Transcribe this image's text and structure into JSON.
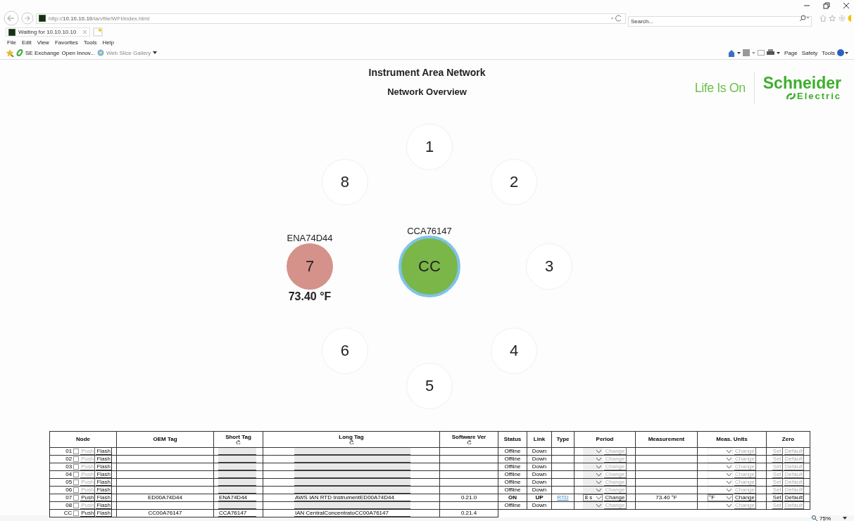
{
  "browser": {
    "url": "http://**10.10.10.10**/ian/file/WFI/index.html",
    "search_placeholder": "Search...",
    "tabs": [
      {
        "title": "Waiting for 10.10.10.10",
        "selected": true
      }
    ],
    "menu": [
      "File",
      "Edit",
      "View",
      "Favorites",
      "Tools",
      "Help"
    ],
    "favorites": [
      {
        "label": "SE Exchange",
        "kind": "link"
      },
      {
        "label": "Open Innov...",
        "kind": "plain"
      },
      {
        "label": "Web Slice Gallery",
        "kind": "gallery"
      }
    ],
    "commands": [
      "Page",
      "Safety",
      "Tools"
    ],
    "zoom": "75%"
  },
  "page": {
    "title": "Instrument Area Network",
    "subtitle": "Network Overview",
    "tagline": "Life Is On",
    "brand": "Schneider",
    "brand_sub": "Electric"
  },
  "center": {
    "label": "CC",
    "tag": "CCA76147"
  },
  "nodes": [
    {
      "label": "1",
      "kind": "empty"
    },
    {
      "label": "2",
      "kind": "empty"
    },
    {
      "label": "3",
      "kind": "empty"
    },
    {
      "label": "4",
      "kind": "empty"
    },
    {
      "label": "5",
      "kind": "empty"
    },
    {
      "label": "6",
      "kind": "empty"
    },
    {
      "label": "7",
      "kind": "sensor",
      "tag": "ENA74D44",
      "reading": "73.40 °F"
    },
    {
      "label": "8",
      "kind": "empty"
    }
  ],
  "table": {
    "columns": [
      {
        "label": "Node"
      },
      {
        "label": "OEM Tag"
      },
      {
        "label": "Short Tag",
        "refresh": true
      },
      {
        "label": "Long Tag",
        "refresh": true
      },
      {
        "label": "Software Ver",
        "refresh": true
      },
      {
        "label": "Status"
      },
      {
        "label": "Link"
      },
      {
        "label": "Type"
      },
      {
        "label": "Period"
      },
      {
        "label": "Measurement"
      },
      {
        "label": "Meas. Units"
      },
      {
        "label": "Zero"
      }
    ],
    "rows": [
      {
        "kind": "node",
        "node": "01",
        "checked": false,
        "enabled": false,
        "push": "Push",
        "flash": "Flash",
        "status": "Offline",
        "link": "Down",
        "period_button": "Change",
        "units_button": "Change",
        "set": "Set",
        "default": "Default"
      },
      {
        "kind": "node",
        "node": "02",
        "checked": false,
        "enabled": false,
        "push": "Push",
        "flash": "Flash",
        "status": "Offline",
        "link": "Down",
        "period_button": "Change",
        "units_button": "Change",
        "set": "Set",
        "default": "Default"
      },
      {
        "kind": "node",
        "node": "03",
        "checked": false,
        "enabled": false,
        "push": "Push",
        "flash": "Flash",
        "status": "Offline",
        "link": "Down",
        "period_button": "Change",
        "units_button": "Change",
        "set": "Set",
        "default": "Default"
      },
      {
        "kind": "node",
        "node": "04",
        "checked": false,
        "enabled": false,
        "push": "Push",
        "flash": "Flash",
        "status": "Offline",
        "link": "Down",
        "period_button": "Change",
        "units_button": "Change",
        "set": "Set",
        "default": "Default"
      },
      {
        "kind": "node",
        "node": "05",
        "checked": false,
        "enabled": false,
        "push": "Push",
        "flash": "Flash",
        "status": "Offline",
        "link": "Down",
        "period_button": "Change",
        "units_button": "Change",
        "set": "Set",
        "default": "Default"
      },
      {
        "kind": "node",
        "node": "06",
        "checked": false,
        "enabled": false,
        "push": "Push",
        "flash": "Flash",
        "status": "Offline",
        "link": "Down",
        "period_button": "Change",
        "units_button": "Change",
        "set": "Set",
        "default": "Default"
      },
      {
        "kind": "node",
        "node": "07",
        "checked": false,
        "enabled": true,
        "push": "Push",
        "flash": "Flash",
        "oem_tag": "ED00A74D44",
        "short_tag": "ENA74D44",
        "long_tag": "AWS IAN RTD InstrumentED00A74D44",
        "software": "0.21.0",
        "status": "ON",
        "link": "UP",
        "type": "RTD",
        "period": "8 s",
        "period_button": "Change",
        "measurement": "73.40 °F",
        "units": "°F",
        "units_button": "Change",
        "set": "Set",
        "default": "Default"
      },
      {
        "kind": "node",
        "node": "08",
        "checked": false,
        "enabled": false,
        "push": "Push",
        "flash": "Flash",
        "status": "Offline",
        "link": "Down",
        "period_button": "Change",
        "units_button": "Change",
        "set": "Set",
        "default": "Default"
      },
      {
        "kind": "concentrator",
        "node": "CC",
        "checked": false,
        "enabled": true,
        "push": "Push",
        "flash": "Flash",
        "oem_tag": "CC00A76147",
        "short_tag": "CCA76147",
        "long_tag": "IAN CentralConcentratoCC00A76147",
        "software": "0.21.4"
      }
    ]
  }
}
